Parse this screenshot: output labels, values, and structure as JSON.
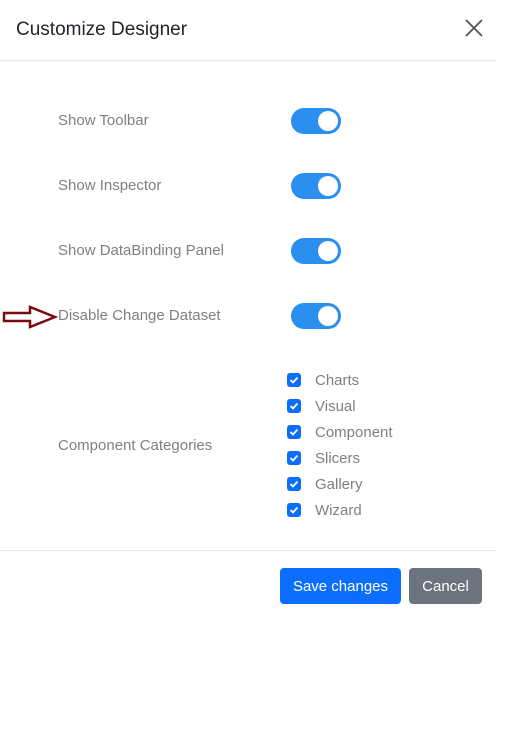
{
  "dialog": {
    "title": "Customize Designer",
    "close_icon": "close-x-icon",
    "settings": [
      {
        "label": "Show Toolbar",
        "enabled": true
      },
      {
        "label": "Show Inspector",
        "enabled": true
      },
      {
        "label": "Show DataBinding Panel",
        "enabled": true
      },
      {
        "label": "Disable Change Dataset",
        "enabled": true
      }
    ],
    "categories_label": "Component Categories",
    "categories": [
      {
        "label": "Charts",
        "checked": true
      },
      {
        "label": "Visual",
        "checked": true
      },
      {
        "label": "Component",
        "checked": true
      },
      {
        "label": "Slicers",
        "checked": true
      },
      {
        "label": "Gallery",
        "checked": true
      },
      {
        "label": "Wizard",
        "checked": true
      }
    ],
    "save_label": "Save changes",
    "cancel_label": "Cancel"
  },
  "annotation": {
    "icon": "arrow-right-outline-icon",
    "color": "#7a0a14"
  },
  "colors": {
    "toggle_on": "#2b8ff0",
    "primary": "#0d6efd",
    "secondary": "#6c757d"
  }
}
